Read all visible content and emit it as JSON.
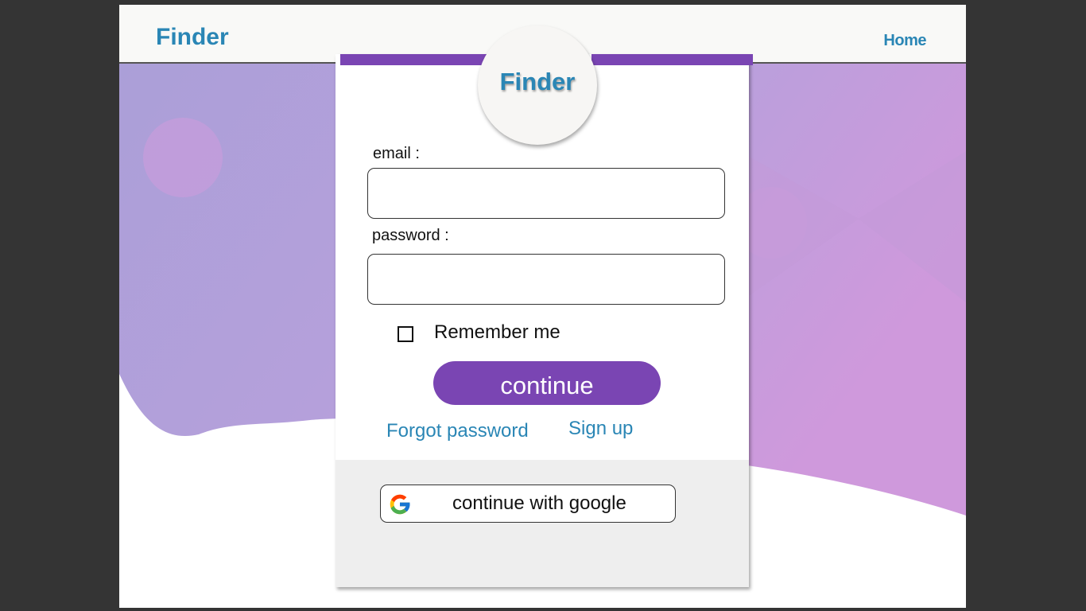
{
  "header": {
    "brand": "Finder",
    "home_link": "Home"
  },
  "card": {
    "logo": "Finder",
    "email_label": "email :",
    "email_value": "",
    "password_label": "password :",
    "password_value": "",
    "remember_label": "Remember me",
    "remember_checked": false,
    "continue_label": "continue",
    "forgot_link": "Forgot password",
    "signup_link": "Sign up",
    "google_label": "continue with google",
    "google_icon": "google-g-icon"
  },
  "colors": {
    "accent": "#7a45b3",
    "brand_text": "#2a86b5",
    "background_gradient_start": "#b19ddb",
    "background_gradient_end": "#d39bdc"
  }
}
